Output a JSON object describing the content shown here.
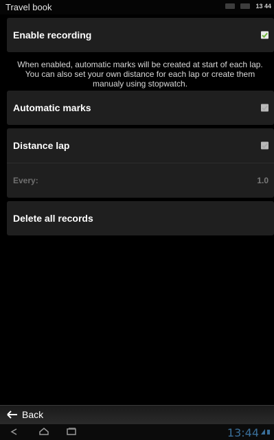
{
  "status_bar": {
    "app_title": "Travel book",
    "time": "13 44"
  },
  "settings": {
    "enable_recording": {
      "label": "Enable recording",
      "checked": true
    },
    "description": "When enabled, automatic marks will be created at start of each lap. You can also set your own distance for each lap or create them manualy using stopwatch.",
    "automatic_marks": {
      "label": "Automatic marks",
      "checked": false
    },
    "distance_lap": {
      "label": "Distance lap",
      "checked": false
    },
    "every": {
      "label": "Every:",
      "value": "1.0"
    },
    "delete_all": {
      "label": "Delete all records"
    }
  },
  "bottom_bar": {
    "back_label": "Back"
  },
  "nav_bar": {
    "clock": "13:44"
  },
  "colors": {
    "checkbox_checked": "#6fb63a",
    "clock_color": "#3a6f9a"
  }
}
